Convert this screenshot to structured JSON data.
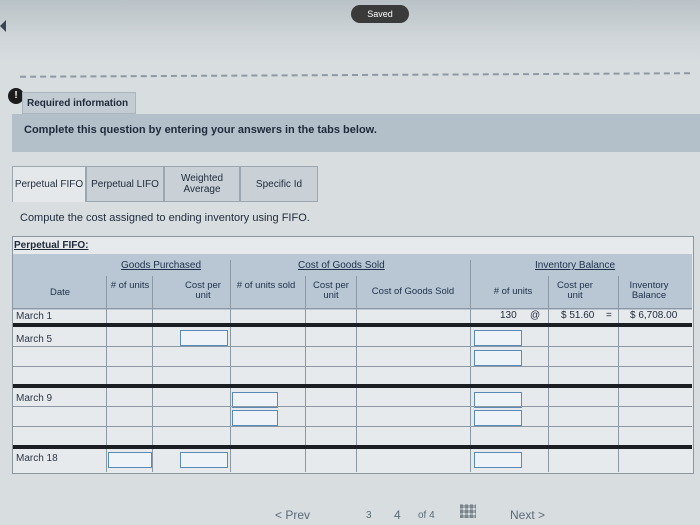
{
  "header": {
    "saved": "Saved"
  },
  "required_info": "Required information",
  "instruction": "Complete this question by entering your answers in the tabs below.",
  "tabs": [
    {
      "label": "Perpetual FIFO",
      "active": true
    },
    {
      "label": "Perpetual LIFO",
      "active": false
    },
    {
      "label": "Weighted Average",
      "active": false
    },
    {
      "label": "Specific Id",
      "active": false
    }
  ],
  "task": "Compute the cost assigned to ending inventory using FIFO.",
  "table": {
    "title": "Perpetual FIFO:",
    "groups": {
      "purchased": "Goods Purchased",
      "sold": "Cost of Goods Sold",
      "balance": "Inventory Balance"
    },
    "columns": {
      "date": "Date",
      "units_purchased": "# of units",
      "cost_per_unit_p": "Cost per unit",
      "units_sold": "# of units sold",
      "cost_per_unit_s": "Cost per unit",
      "cogs": "Cost of Goods Sold",
      "units_balance": "# of units",
      "cost_per_unit_b": "Cost per unit",
      "inv_balance": "Inventory Balance"
    },
    "rows": [
      {
        "date": "March 1",
        "units": "130",
        "at": "@",
        "cost": "$ 51.60",
        "eq": "=",
        "balance": "$ 6,708.00"
      },
      {
        "date": "March 5"
      },
      {
        "date": "March 9"
      },
      {
        "date": "March 18"
      }
    ]
  },
  "footer": {
    "prev": "Prev",
    "pages": [
      "3",
      "4"
    ],
    "of": "of 4",
    "next": "Next"
  }
}
